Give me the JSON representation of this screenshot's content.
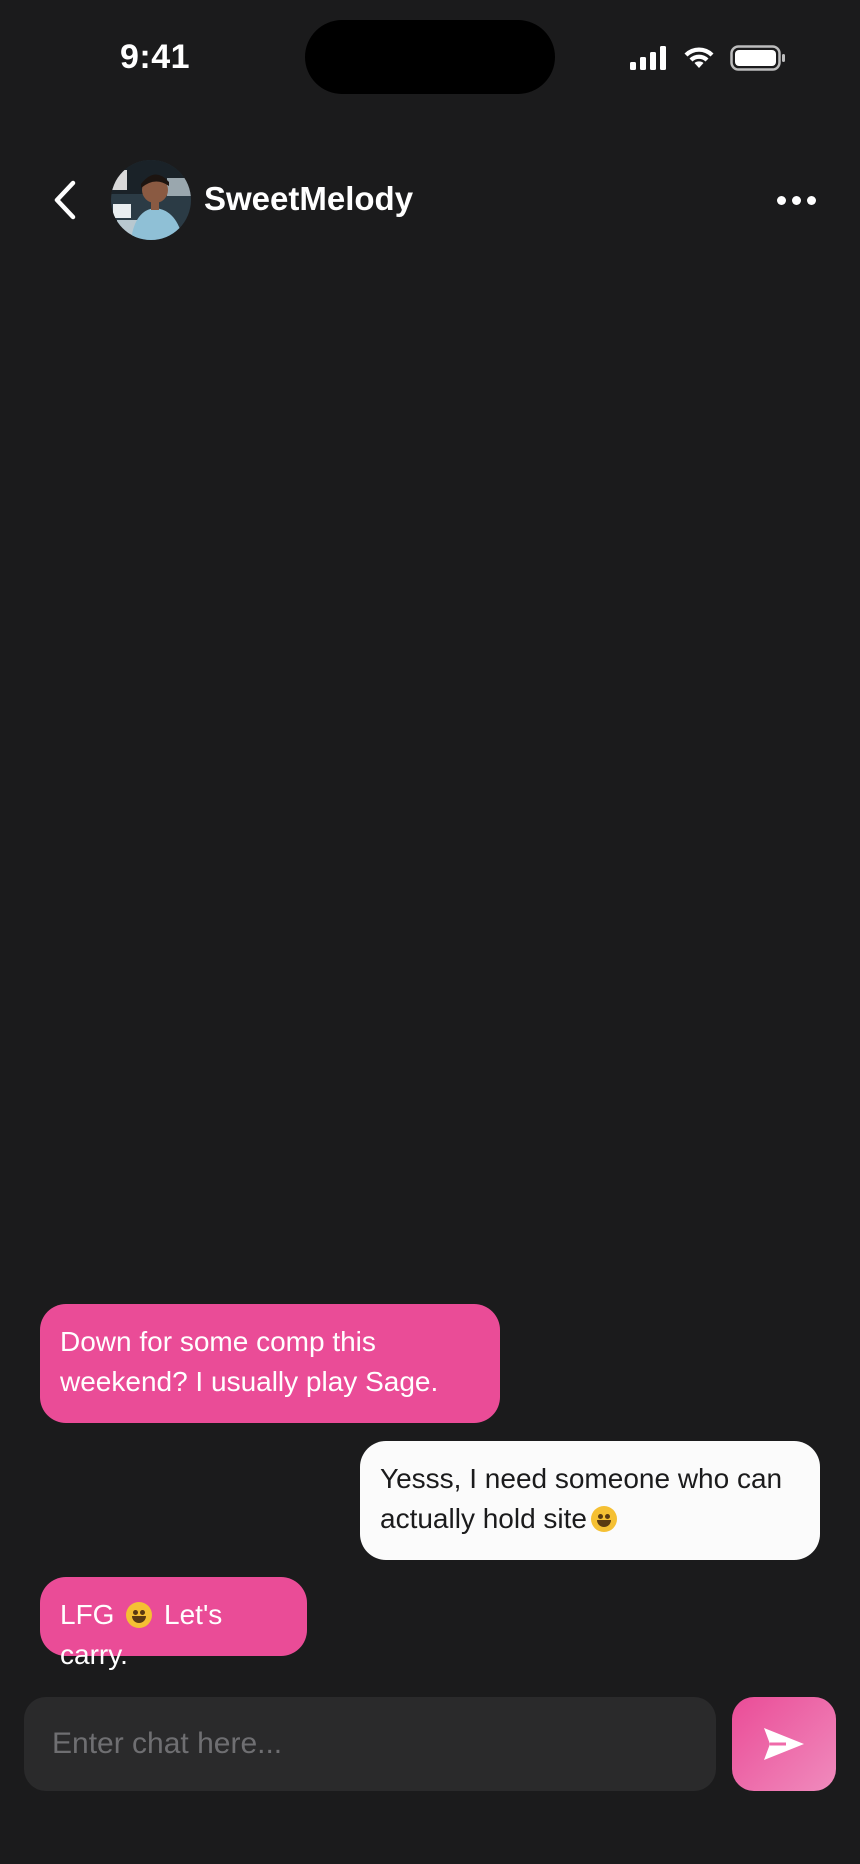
{
  "status_bar": {
    "time": "9:41",
    "icons": [
      "signal-icon",
      "wifi-icon",
      "battery-icon"
    ]
  },
  "header": {
    "back_icon": "chevron-left-icon",
    "contact_name": "SweetMelody",
    "more_icon": "more-horizontal-icon"
  },
  "messages": [
    {
      "sender": "contact",
      "parts": [
        "Down for some comp this weekend? I usually play Sage."
      ]
    },
    {
      "sender": "me",
      "parts": [
        "Yesss, I need someone who can actually hold site",
        ""
      ]
    },
    {
      "sender": "contact",
      "parts": [
        "LFG",
        " Let's carry."
      ]
    }
  ],
  "composer": {
    "placeholder": "Enter chat here...",
    "send_icon": "send-icon"
  },
  "colors": {
    "background": "#1b1b1c",
    "incoming_bubble": "#ea4c97",
    "outgoing_bubble": "#fbfbfb",
    "input_background": "#2a2a2b"
  }
}
